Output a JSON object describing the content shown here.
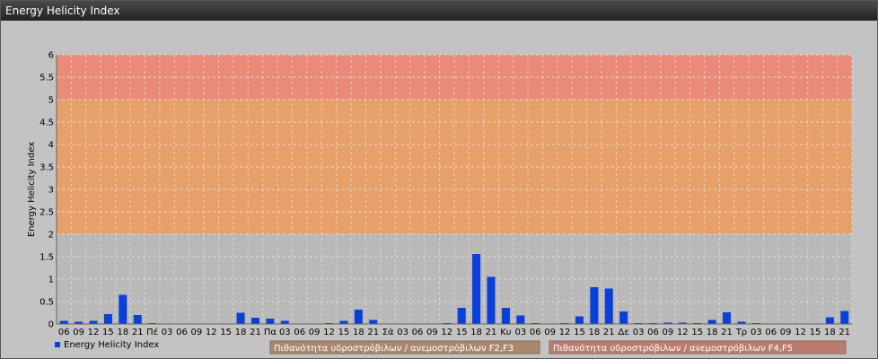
{
  "window": {
    "title": "Energy Helicity Index"
  },
  "chart_data": {
    "type": "bar",
    "ylabel": "Energy Helicity Index",
    "ylim": [
      0,
      6
    ],
    "y_ticks": [
      "0",
      "0.5",
      "1",
      "1.5",
      "2",
      "2.5",
      "3",
      "3.5",
      "4",
      "4.5",
      "5",
      "5.5",
      "6"
    ],
    "grid": true,
    "legend_position": "bottom-left",
    "categories": [
      "06",
      "09",
      "12",
      "15",
      "18",
      "21",
      "Πέ",
      "03",
      "06",
      "09",
      "12",
      "15",
      "18",
      "21",
      "Πα",
      "03",
      "06",
      "09",
      "12",
      "15",
      "18",
      "21",
      "Σά",
      "03",
      "06",
      "09",
      "12",
      "15",
      "18",
      "21",
      "Κυ",
      "03",
      "06",
      "09",
      "12",
      "15",
      "18",
      "21",
      "Δε",
      "03",
      "06",
      "09",
      "12",
      "15",
      "18",
      "21",
      "Τρ",
      "03",
      "06",
      "09",
      "12",
      "15",
      "18",
      "21"
    ],
    "series": [
      {
        "name": "Energy Helicity Index",
        "color": "#0a3fd8",
        "values": [
          0.07,
          0.05,
          0.07,
          0.22,
          0.65,
          0.2,
          0.02,
          0.01,
          0.01,
          0.01,
          0.01,
          0.01,
          0.25,
          0.14,
          0.12,
          0.07,
          0.01,
          0.01,
          0.02,
          0.07,
          0.32,
          0.09,
          0.01,
          0.01,
          0.01,
          0.01,
          0.02,
          0.36,
          1.56,
          1.05,
          0.36,
          0.19,
          0.02,
          0.01,
          0.02,
          0.17,
          0.82,
          0.79,
          0.28,
          0.02,
          0.02,
          0.03,
          0.03,
          0.02,
          0.09,
          0.26,
          0.05,
          0.02,
          0.01,
          0.01,
          0.01,
          0.01,
          0.15,
          0.29
        ]
      }
    ],
    "bands": [
      {
        "from": 2,
        "to": 5,
        "label": "Πιθανότητα υδροστρόβιλων / ανεμοστρόβιλων F2,F3",
        "color": "#e8a06a",
        "label_color": "#a9886f"
      },
      {
        "from": 5,
        "to": 6,
        "label": "Πιθανότητα υδροστρόβιλων / ανεμοστρόβιλων F4,F5",
        "color": "#ea8a78",
        "label_color": "#bb7c70"
      }
    ]
  }
}
